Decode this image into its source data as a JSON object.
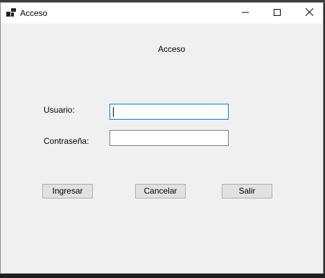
{
  "window": {
    "title": "Acceso",
    "icon": "windows-form-icon"
  },
  "form": {
    "heading": "Acceso",
    "usuario_label": "Usuario:",
    "usuario_value": "",
    "contrasena_label": "Contraseña:",
    "contrasena_value": ""
  },
  "buttons": {
    "ingresar": "Ingresar",
    "cancelar": "Cancelar",
    "salir": "Salir"
  },
  "colors": {
    "window_bg": "#f0f0f0",
    "titlebar_bg": "#ffffff",
    "focus_border": "#0078d7",
    "button_bg": "#e1e1e1"
  }
}
